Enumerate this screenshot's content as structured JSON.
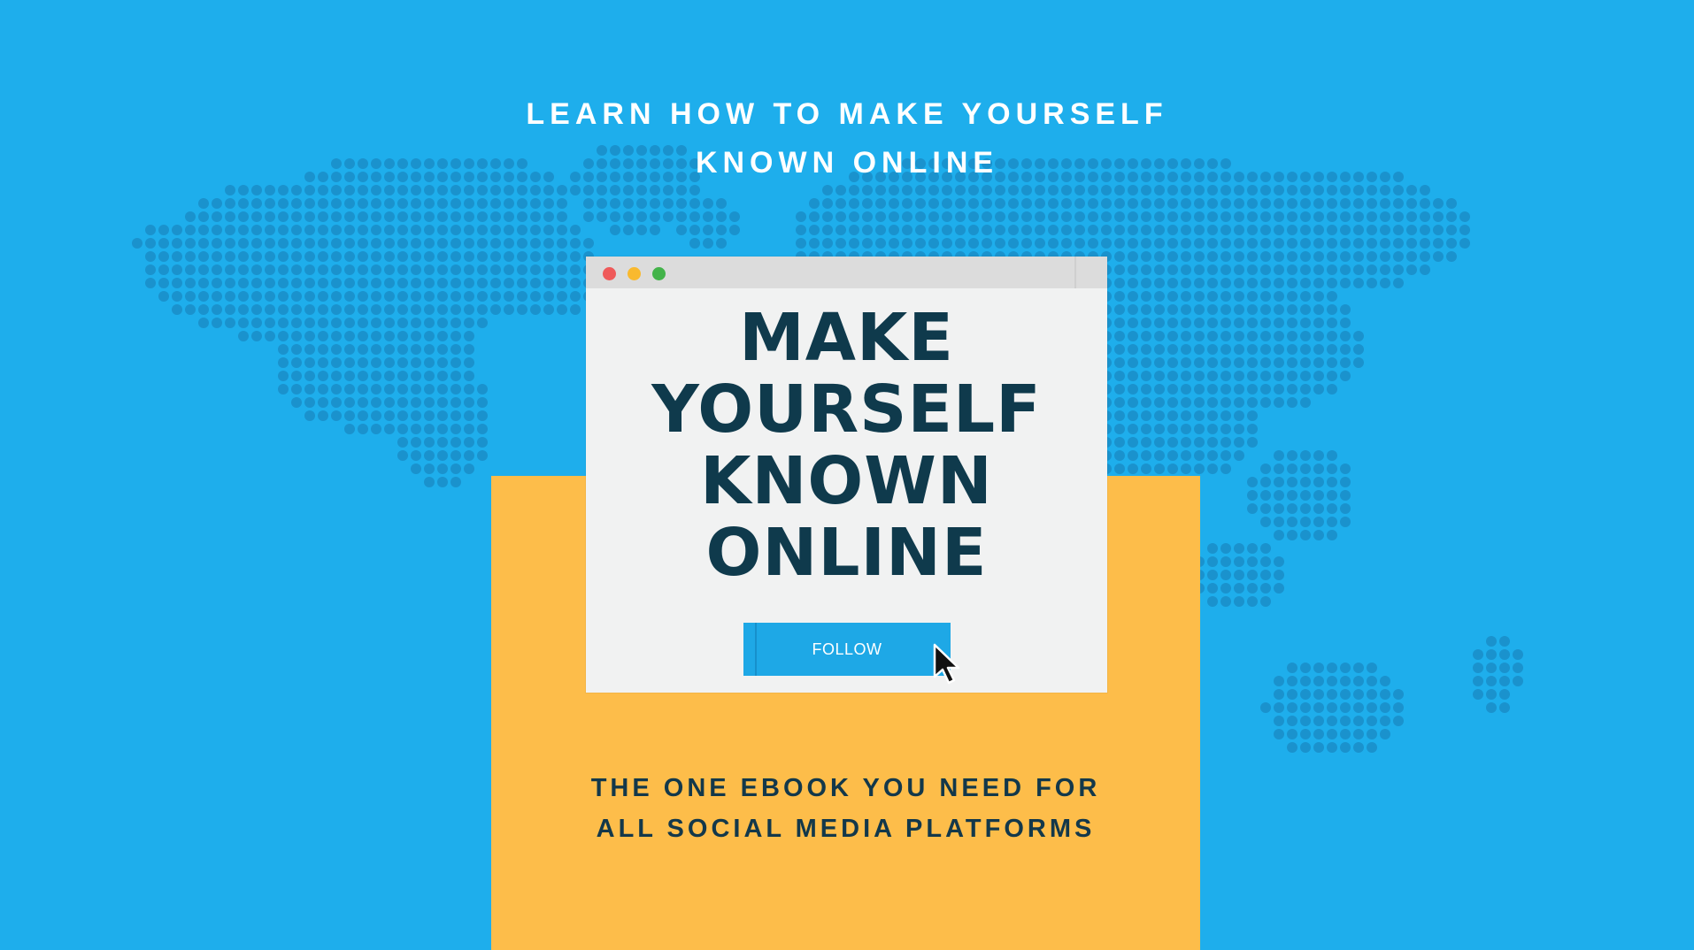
{
  "colors": {
    "background": "#1eaeec",
    "map_dots": "#1a92cd",
    "panel": "#fdbd4a",
    "window": "#f1f2f2",
    "title_bar": "#dcdcdc",
    "heading_text": "#0f3a4c",
    "button": "#1ea8e6",
    "dot_close": "#ef5a5a",
    "dot_minimize": "#f9b92e",
    "dot_maximize": "#43b34a"
  },
  "header": {
    "line1": "LEARN HOW TO MAKE YOURSELF",
    "line2": "KNOWN ONLINE"
  },
  "browser": {
    "window_controls": [
      "close-dot",
      "minimize-dot",
      "maximize-dot"
    ],
    "title_lines": [
      "MAKE",
      "YOURSELF",
      "KNOWN",
      "ONLINE"
    ],
    "button_label": "FOLLOW"
  },
  "footer": {
    "line1": "THE ONE EBOOK YOU NEED FOR",
    "line2": "ALL SOCIAL MEDIA PLATFORMS"
  },
  "icons": {
    "background": "world-map-dots-icon",
    "pointer": "mouse-pointer-icon"
  }
}
